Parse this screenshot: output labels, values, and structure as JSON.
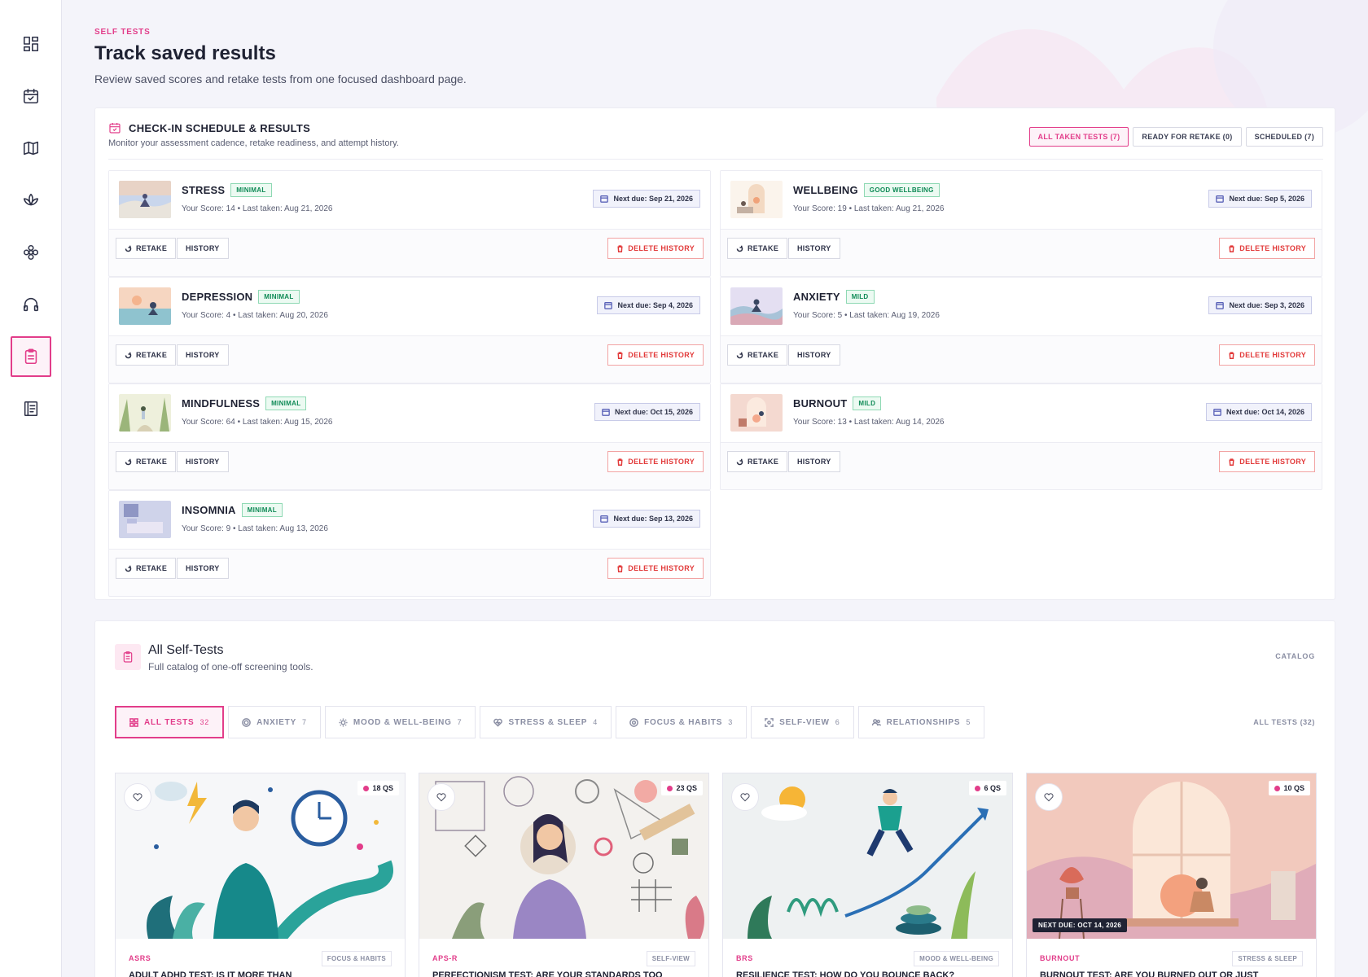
{
  "sidebar": {
    "items": [
      {
        "icon": "dashboard-icon",
        "active": false
      },
      {
        "icon": "calendar-check-icon",
        "active": false
      },
      {
        "icon": "map-icon",
        "active": false
      },
      {
        "icon": "lotus-icon",
        "active": false
      },
      {
        "icon": "flower-icon",
        "active": false
      },
      {
        "icon": "headphones-icon",
        "active": false
      },
      {
        "icon": "clipboard-icon",
        "active": true
      },
      {
        "icon": "journal-icon",
        "active": false
      }
    ]
  },
  "header": {
    "eyebrow": "SELF TESTS",
    "title": "Track saved results",
    "subtitle": "Review saved scores and retake tests from one focused dashboard page."
  },
  "schedule": {
    "title": "CHECK-IN SCHEDULE & RESULTS",
    "description": "Monitor your assessment cadence, retake readiness, and attempt history.",
    "filters": [
      {
        "label": "ALL TAKEN TESTS (7)",
        "active": true
      },
      {
        "label": "READY FOR RETAKE (0)",
        "active": false
      },
      {
        "label": "SCHEDULED (7)",
        "active": false
      }
    ],
    "retake_label": "RETAKE",
    "history_label": "HISTORY",
    "delete_label": "DELETE HISTORY",
    "tests": [
      {
        "name": "STRESS",
        "badge": "MINIMAL",
        "meta": "Your Score: 14  •  Last taken: Aug 21, 2026",
        "due": "Next due: Sep 21, 2026"
      },
      {
        "name": "WELLBEING",
        "badge": "GOOD WELLBEING",
        "meta": "Your Score: 19  •  Last taken: Aug 21, 2026",
        "due": "Next due: Sep 5, 2026"
      },
      {
        "name": "DEPRESSION",
        "badge": "MINIMAL",
        "meta": "Your Score: 4  •  Last taken: Aug 20, 2026",
        "due": "Next due: Sep 4, 2026"
      },
      {
        "name": "ANXIETY",
        "badge": "MILD",
        "meta": "Your Score: 5  •  Last taken: Aug 19, 2026",
        "due": "Next due: Sep 3, 2026"
      },
      {
        "name": "MINDFULNESS",
        "badge": "MINIMAL",
        "meta": "Your Score: 64  •  Last taken: Aug 15, 2026",
        "due": "Next due: Oct 15, 2026"
      },
      {
        "name": "BURNOUT",
        "badge": "MILD",
        "meta": "Your Score: 13  •  Last taken: Aug 14, 2026",
        "due": "Next due: Oct 14, 2026"
      },
      {
        "name": "INSOMNIA",
        "badge": "MINIMAL",
        "meta": "Your Score: 9  •  Last taken: Aug 13, 2026",
        "due": "Next due: Sep 13, 2026"
      }
    ]
  },
  "catalog": {
    "title": "All Self-Tests",
    "description": "Full catalog of one-off screening tools.",
    "tag": "CATALOG",
    "tabs_summary": "ALL TESTS (32)",
    "tabs": [
      {
        "label": "ALL TESTS",
        "count": "32",
        "icon": "grid-icon",
        "active": true
      },
      {
        "label": "ANXIETY",
        "count": "7",
        "icon": "spiral-icon",
        "active": false
      },
      {
        "label": "MOOD & WELL-BEING",
        "count": "7",
        "icon": "sun-icon",
        "active": false
      },
      {
        "label": "STRESS & SLEEP",
        "count": "4",
        "icon": "heart-pulse-icon",
        "active": false
      },
      {
        "label": "FOCUS & HABITS",
        "count": "3",
        "icon": "target-icon",
        "active": false
      },
      {
        "label": "SELF-VIEW",
        "count": "6",
        "icon": "scan-icon",
        "active": false
      },
      {
        "label": "RELATIONSHIPS",
        "count": "5",
        "icon": "people-icon",
        "active": false
      }
    ],
    "cards": [
      {
        "qs": "18 QS",
        "abbr": "ASRS",
        "category": "FOCUS & HABITS",
        "title": "ADULT ADHD TEST: IS IT MORE THAN",
        "due": ""
      },
      {
        "qs": "23 QS",
        "abbr": "APS-R",
        "category": "SELF-VIEW",
        "title": "PERFECTIONISM TEST: ARE YOUR STANDARDS TOO",
        "due": ""
      },
      {
        "qs": "6 QS",
        "abbr": "BRS",
        "category": "MOOD & WELL-BEING",
        "title": "RESILIENCE TEST: HOW DO YOU BOUNCE BACK?",
        "due": ""
      },
      {
        "qs": "10 QS",
        "abbr": "BURNOUT",
        "category": "STRESS & SLEEP",
        "title": "BURNOUT TEST: ARE YOU BURNED OUT OR JUST",
        "due": "NEXT DUE: OCT 14, 2026"
      }
    ]
  }
}
